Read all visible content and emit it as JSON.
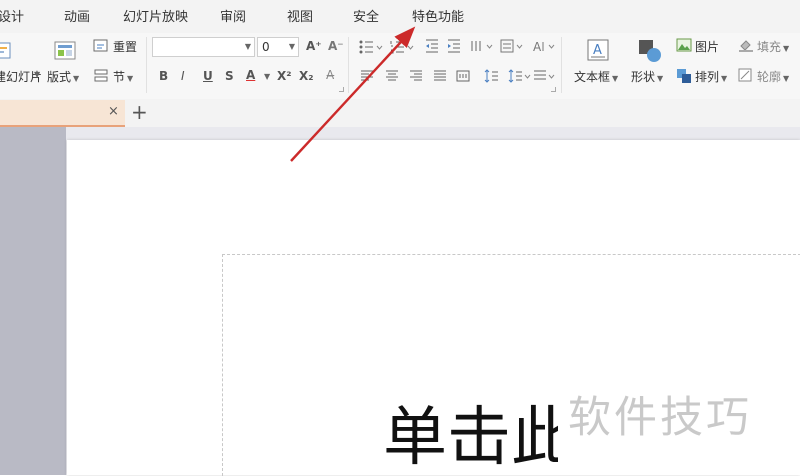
{
  "menu": {
    "items": [
      "设计",
      "动画",
      "幻灯片放映",
      "审阅",
      "视图",
      "安全",
      "特色功能"
    ]
  },
  "ribbon": {
    "new_slide_label": "新建幻灯片",
    "layout_label": "版式",
    "reset_label": "重置",
    "section_label": "节",
    "font_name_value": "",
    "font_size_value": "0",
    "text_box_label": "文本框",
    "shape_label": "形状",
    "picture_label": "图片",
    "arrange_label": "排列",
    "fill_label": "填充",
    "outline_label": "轮廓"
  },
  "tabbar": {
    "close_label": "×",
    "new_tab_label": "+"
  },
  "slide": {
    "title_text": "单击此处添加标题"
  },
  "watermark": {
    "text": "软件技巧"
  },
  "colors": {
    "arrow": "#cc2a2a",
    "tab_active_bg": "#f7e5d5",
    "tab_active_border": "#e8a27a",
    "left_panel": "#b9bac5"
  },
  "icons": [
    "new-slide-icon",
    "layout-icon",
    "reset-icon",
    "section-icon",
    "text-box-icon",
    "shape-icon",
    "picture-icon",
    "arrange-icon",
    "fill-icon",
    "outline-icon"
  ]
}
